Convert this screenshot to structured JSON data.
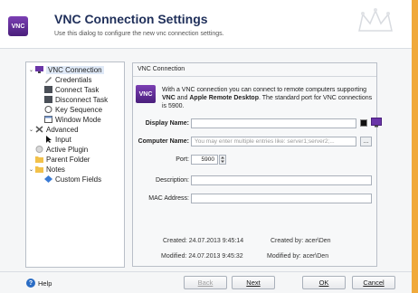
{
  "header": {
    "logo_text": "VNC",
    "title": "VNC Connection Settings",
    "subtitle": "Use this dialog to configure the new vnc connection settings."
  },
  "tree": {
    "items": [
      {
        "label": "VNC Connection",
        "icon": "vnc-monitor-icon",
        "level": 0,
        "expanded": true,
        "selected": true
      },
      {
        "label": "Credentials",
        "icon": "key-pen-icon",
        "level": 1
      },
      {
        "label": "Connect Task",
        "icon": "task-icon",
        "level": 1
      },
      {
        "label": "Disconnect Task",
        "icon": "task-icon",
        "level": 1
      },
      {
        "label": "Key Sequence",
        "icon": "keyboard-icon",
        "level": 1
      },
      {
        "label": "Window Mode",
        "icon": "window-icon",
        "level": 1
      },
      {
        "label": "Advanced",
        "icon": "tools-icon",
        "level": 0,
        "expanded": true
      },
      {
        "label": "Input",
        "icon": "cursor-icon",
        "level": 1
      },
      {
        "label": "Active Plugin",
        "icon": "plugin-icon",
        "level": 0
      },
      {
        "label": "Parent Folder",
        "icon": "folder-icon",
        "level": 0
      },
      {
        "label": "Notes",
        "icon": "notes-folder-icon",
        "level": 0,
        "expanded": true
      },
      {
        "label": "Custom Fields",
        "icon": "custom-fields-icon",
        "level": 1
      }
    ]
  },
  "panel": {
    "title": "VNC Connection",
    "logo_text": "VNC",
    "description_prefix": "With a VNC connection you can connect to remote computers supporting ",
    "description_bold1": "VNC",
    "description_mid": " and ",
    "description_bold2": "Apple Remote Desktop",
    "description_suffix": ". The standard port for VNC connections is 5900."
  },
  "form": {
    "display_name_label": "Display Name:",
    "display_name_value": "",
    "computer_name_label": "Computer Name:",
    "computer_name_placeholder": "You may enter multiple entries like: server1;server2;...",
    "browse_label": "...",
    "port_label": "Port:",
    "port_value": "5900",
    "description_label": "Description:",
    "description_value": "",
    "mac_label": "MAC Address:",
    "mac_value": ""
  },
  "meta": {
    "created": "Created: 24.07.2013 9:45:14",
    "created_by": "Created by: acer\\Den",
    "modified": "Modified: 24.07.2013 9:45:32",
    "modified_by": "Modified by: acer\\Den"
  },
  "footer": {
    "help": "Help",
    "back": "Back",
    "next": "Next",
    "ok": "OK",
    "cancel": "Cancel"
  },
  "colors": {
    "accent": "#2a6cc4",
    "vnc_purple": "#5a2a92",
    "background_strip": "#f0a93a"
  }
}
